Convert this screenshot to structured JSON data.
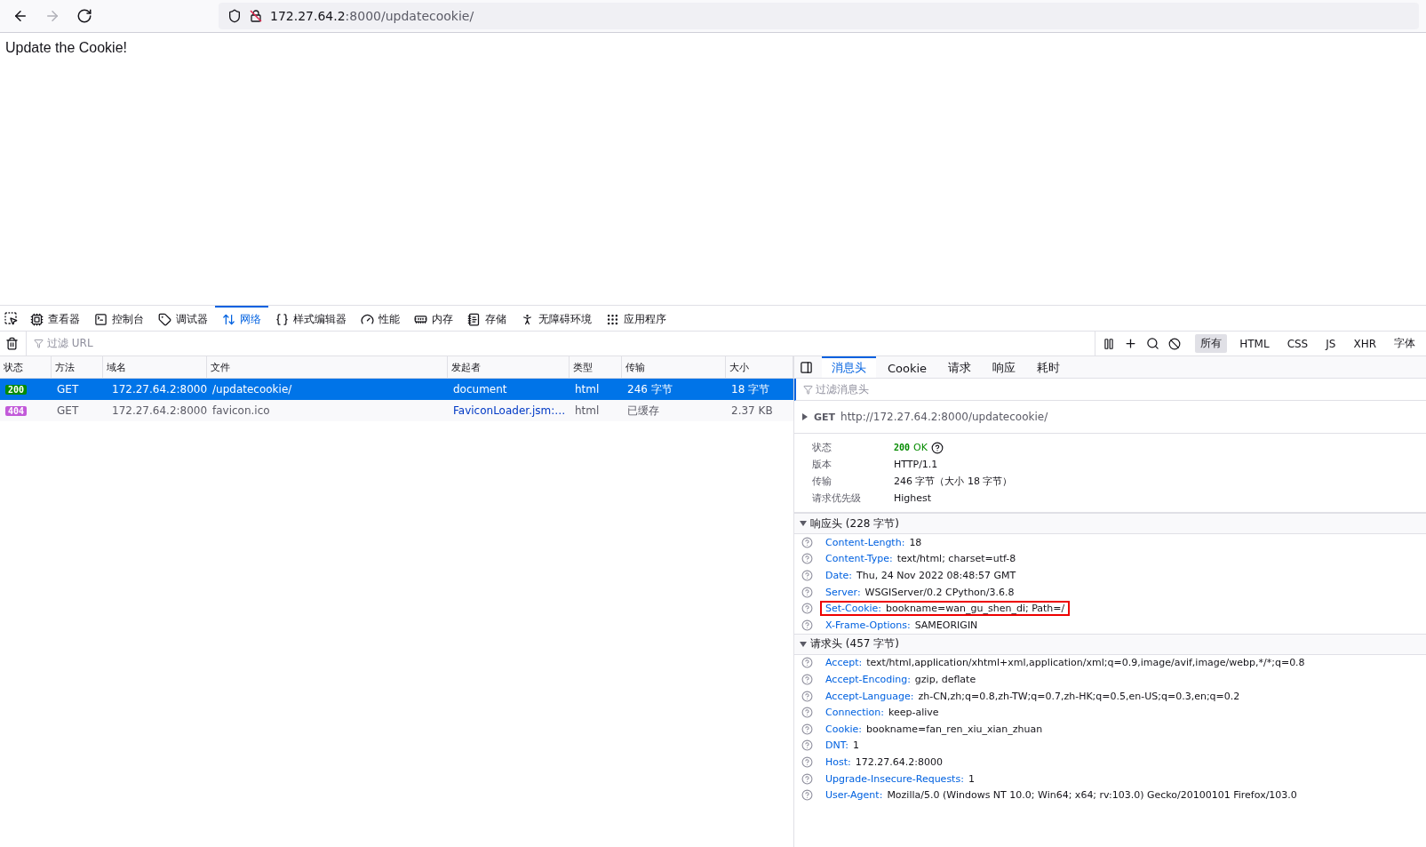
{
  "browser": {
    "nav": [
      {
        "kind": "back",
        "disabled": false
      },
      {
        "kind": "forward",
        "disabled": true
      },
      {
        "kind": "reload",
        "disabled": false
      }
    ],
    "url_host": "172.27.64.2",
    "url_rest": ":8000/updatecookie/"
  },
  "page": {
    "text": "Update the Cookie!"
  },
  "devtools": {
    "tabs": [
      {
        "kind": "viewer",
        "label": "查看器",
        "selected": false
      },
      {
        "kind": "console",
        "label": "控制台",
        "selected": false
      },
      {
        "kind": "debugger",
        "label": "调试器",
        "selected": false
      },
      {
        "kind": "network",
        "label": "网络",
        "selected": true
      },
      {
        "kind": "style",
        "label": "样式编辑器",
        "selected": false
      },
      {
        "kind": "perf",
        "label": "性能",
        "selected": false
      },
      {
        "kind": "memory",
        "label": "内存",
        "selected": false
      },
      {
        "kind": "storage",
        "label": "存储",
        "selected": false
      },
      {
        "kind": "a11y",
        "label": "无障碍环境",
        "selected": false
      },
      {
        "kind": "apps",
        "label": "应用程序",
        "selected": false
      }
    ],
    "filter": {
      "placeholder": "过滤 URL"
    },
    "type_filters": [
      {
        "label": "所有",
        "selected": true
      },
      {
        "label": "HTML",
        "selected": false
      },
      {
        "label": "CSS",
        "selected": false
      },
      {
        "label": "JS",
        "selected": false
      },
      {
        "label": "XHR",
        "selected": false
      },
      {
        "label": "字体",
        "selected": false
      }
    ]
  },
  "table": {
    "columns": [
      "状态",
      "方法",
      "域名",
      "文件",
      "发起者",
      "类型",
      "传输",
      "大小"
    ],
    "rows": [
      {
        "status": "200",
        "color": "#058b00",
        "method": "GET",
        "domain": "172.27.64.2:8000",
        "file": "/updatecookie/",
        "initiator": "document",
        "type": "html",
        "transfer": "246 字节",
        "size": "18 字节",
        "selected": true
      },
      {
        "status": "404",
        "color": "#c25ad9",
        "method": "GET",
        "domain": "172.27.64.2:8000",
        "file": "favicon.ico",
        "initiator": "FaviconLoader.jsm:…",
        "type": "html",
        "transfer": "已缓存",
        "size": "2.37 KB",
        "selected": false
      }
    ]
  },
  "details": {
    "tabs": [
      {
        "label": "消息头",
        "selected": true
      },
      {
        "label": "Cookie",
        "selected": false
      },
      {
        "label": "请求",
        "selected": false
      },
      {
        "label": "响应",
        "selected": false
      },
      {
        "label": "耗时",
        "selected": false
      }
    ],
    "filter": {
      "placeholder": "过滤消息头"
    },
    "request": {
      "method": "GET",
      "url": "http://172.27.64.2:8000/updatecookie/",
      "expanded": false
    },
    "summary": [
      {
        "kind": "status",
        "label": "状态",
        "code": "200",
        "value": "OK"
      },
      {
        "kind": "text",
        "label": "版本",
        "value": "HTTP/1.1"
      },
      {
        "kind": "text",
        "label": "传输",
        "value": "246 字节（大小 18 字节）"
      },
      {
        "kind": "text",
        "label": "请求优先级",
        "value": "Highest"
      }
    ],
    "sections": [
      {
        "title": "响应头 (228 字节)",
        "expanded": true,
        "headers": [
          {
            "name": "Content-Length:",
            "value": "18",
            "highlighted": false
          },
          {
            "name": "Content-Type:",
            "value": "text/html; charset=utf-8",
            "highlighted": false
          },
          {
            "name": "Date:",
            "value": "Thu, 24 Nov 2022 08:48:57 GMT",
            "highlighted": false
          },
          {
            "name": "Server:",
            "value": "WSGIServer/0.2 CPython/3.6.8",
            "highlighted": false
          },
          {
            "name": "Set-Cookie:",
            "value": "bookname=wan_gu_shen_di; Path=/",
            "highlighted": true
          },
          {
            "name": "X-Frame-Options:",
            "value": "SAMEORIGIN",
            "highlighted": false
          }
        ]
      },
      {
        "title": "请求头 (457 字节)",
        "expanded": true,
        "headers": [
          {
            "name": "Accept:",
            "value": "text/html,application/xhtml+xml,application/xml;q=0.9,image/avif,image/webp,*/*;q=0.8",
            "highlighted": false
          },
          {
            "name": "Accept-Encoding:",
            "value": "gzip, deflate",
            "highlighted": false
          },
          {
            "name": "Accept-Language:",
            "value": "zh-CN,zh;q=0.8,zh-TW;q=0.7,zh-HK;q=0.5,en-US;q=0.3,en;q=0.2",
            "highlighted": false
          },
          {
            "name": "Connection:",
            "value": "keep-alive",
            "highlighted": false
          },
          {
            "name": "Cookie:",
            "value": "bookname=fan_ren_xiu_xian_zhuan",
            "highlighted": false
          },
          {
            "name": "DNT:",
            "value": "1",
            "highlighted": false
          },
          {
            "name": "Host:",
            "value": "172.27.64.2:8000",
            "highlighted": false
          },
          {
            "name": "Upgrade-Insecure-Requests:",
            "value": "1",
            "highlighted": false
          },
          {
            "name": "User-Agent:",
            "value": "Mozilla/5.0 (Windows NT 10.0; Win64; x64; rv:103.0) Gecko/20100101 Firefox/103.0",
            "highlighted": false
          }
        ]
      }
    ]
  }
}
